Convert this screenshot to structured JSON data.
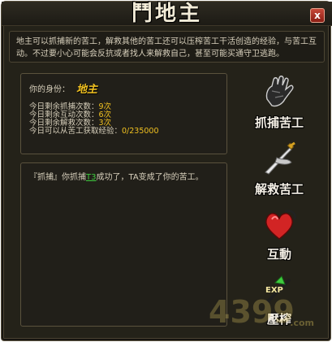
{
  "window": {
    "title": "鬥地主",
    "close_label": "x"
  },
  "intro": {
    "text": "地主可以抓捕新的苦工，解救其他的苦工还可以压榨苦工干活创造的经验，与苦工互动。不过要小心可能会反抗或者找人来解救自己，甚至可能买通守卫逃跑。"
  },
  "status": {
    "identity_label": "你的身份：",
    "identity_value": "地主",
    "stats": [
      {
        "label": "今日剩余抓捕次数：",
        "value": "9次"
      },
      {
        "label": "今日剩余互动次数：",
        "value": "6次"
      },
      {
        "label": "今日剩余解救次数：",
        "value": "3次"
      },
      {
        "label": "今日可以从苦工获取经验：",
        "value": "0/235000"
      }
    ]
  },
  "log": {
    "prefix": "『抓捕』你抓捕",
    "target": "T3",
    "suffix": "成功了，TA变成了你的苦工。"
  },
  "actions": [
    {
      "label": "抓捕苦工",
      "icon": "glove-icon"
    },
    {
      "label": "解救苦工",
      "icon": "sword-icon"
    },
    {
      "label": "互動",
      "icon": "heart-whip-icon"
    },
    {
      "label": "壓榨",
      "icon": "exp-arrow-icon"
    }
  ],
  "watermark": {
    "text": "4399",
    "suffix": ".com"
  },
  "colors": {
    "highlight": "#f0c020",
    "link": "#3ecb3e",
    "close": "#b8322a"
  }
}
